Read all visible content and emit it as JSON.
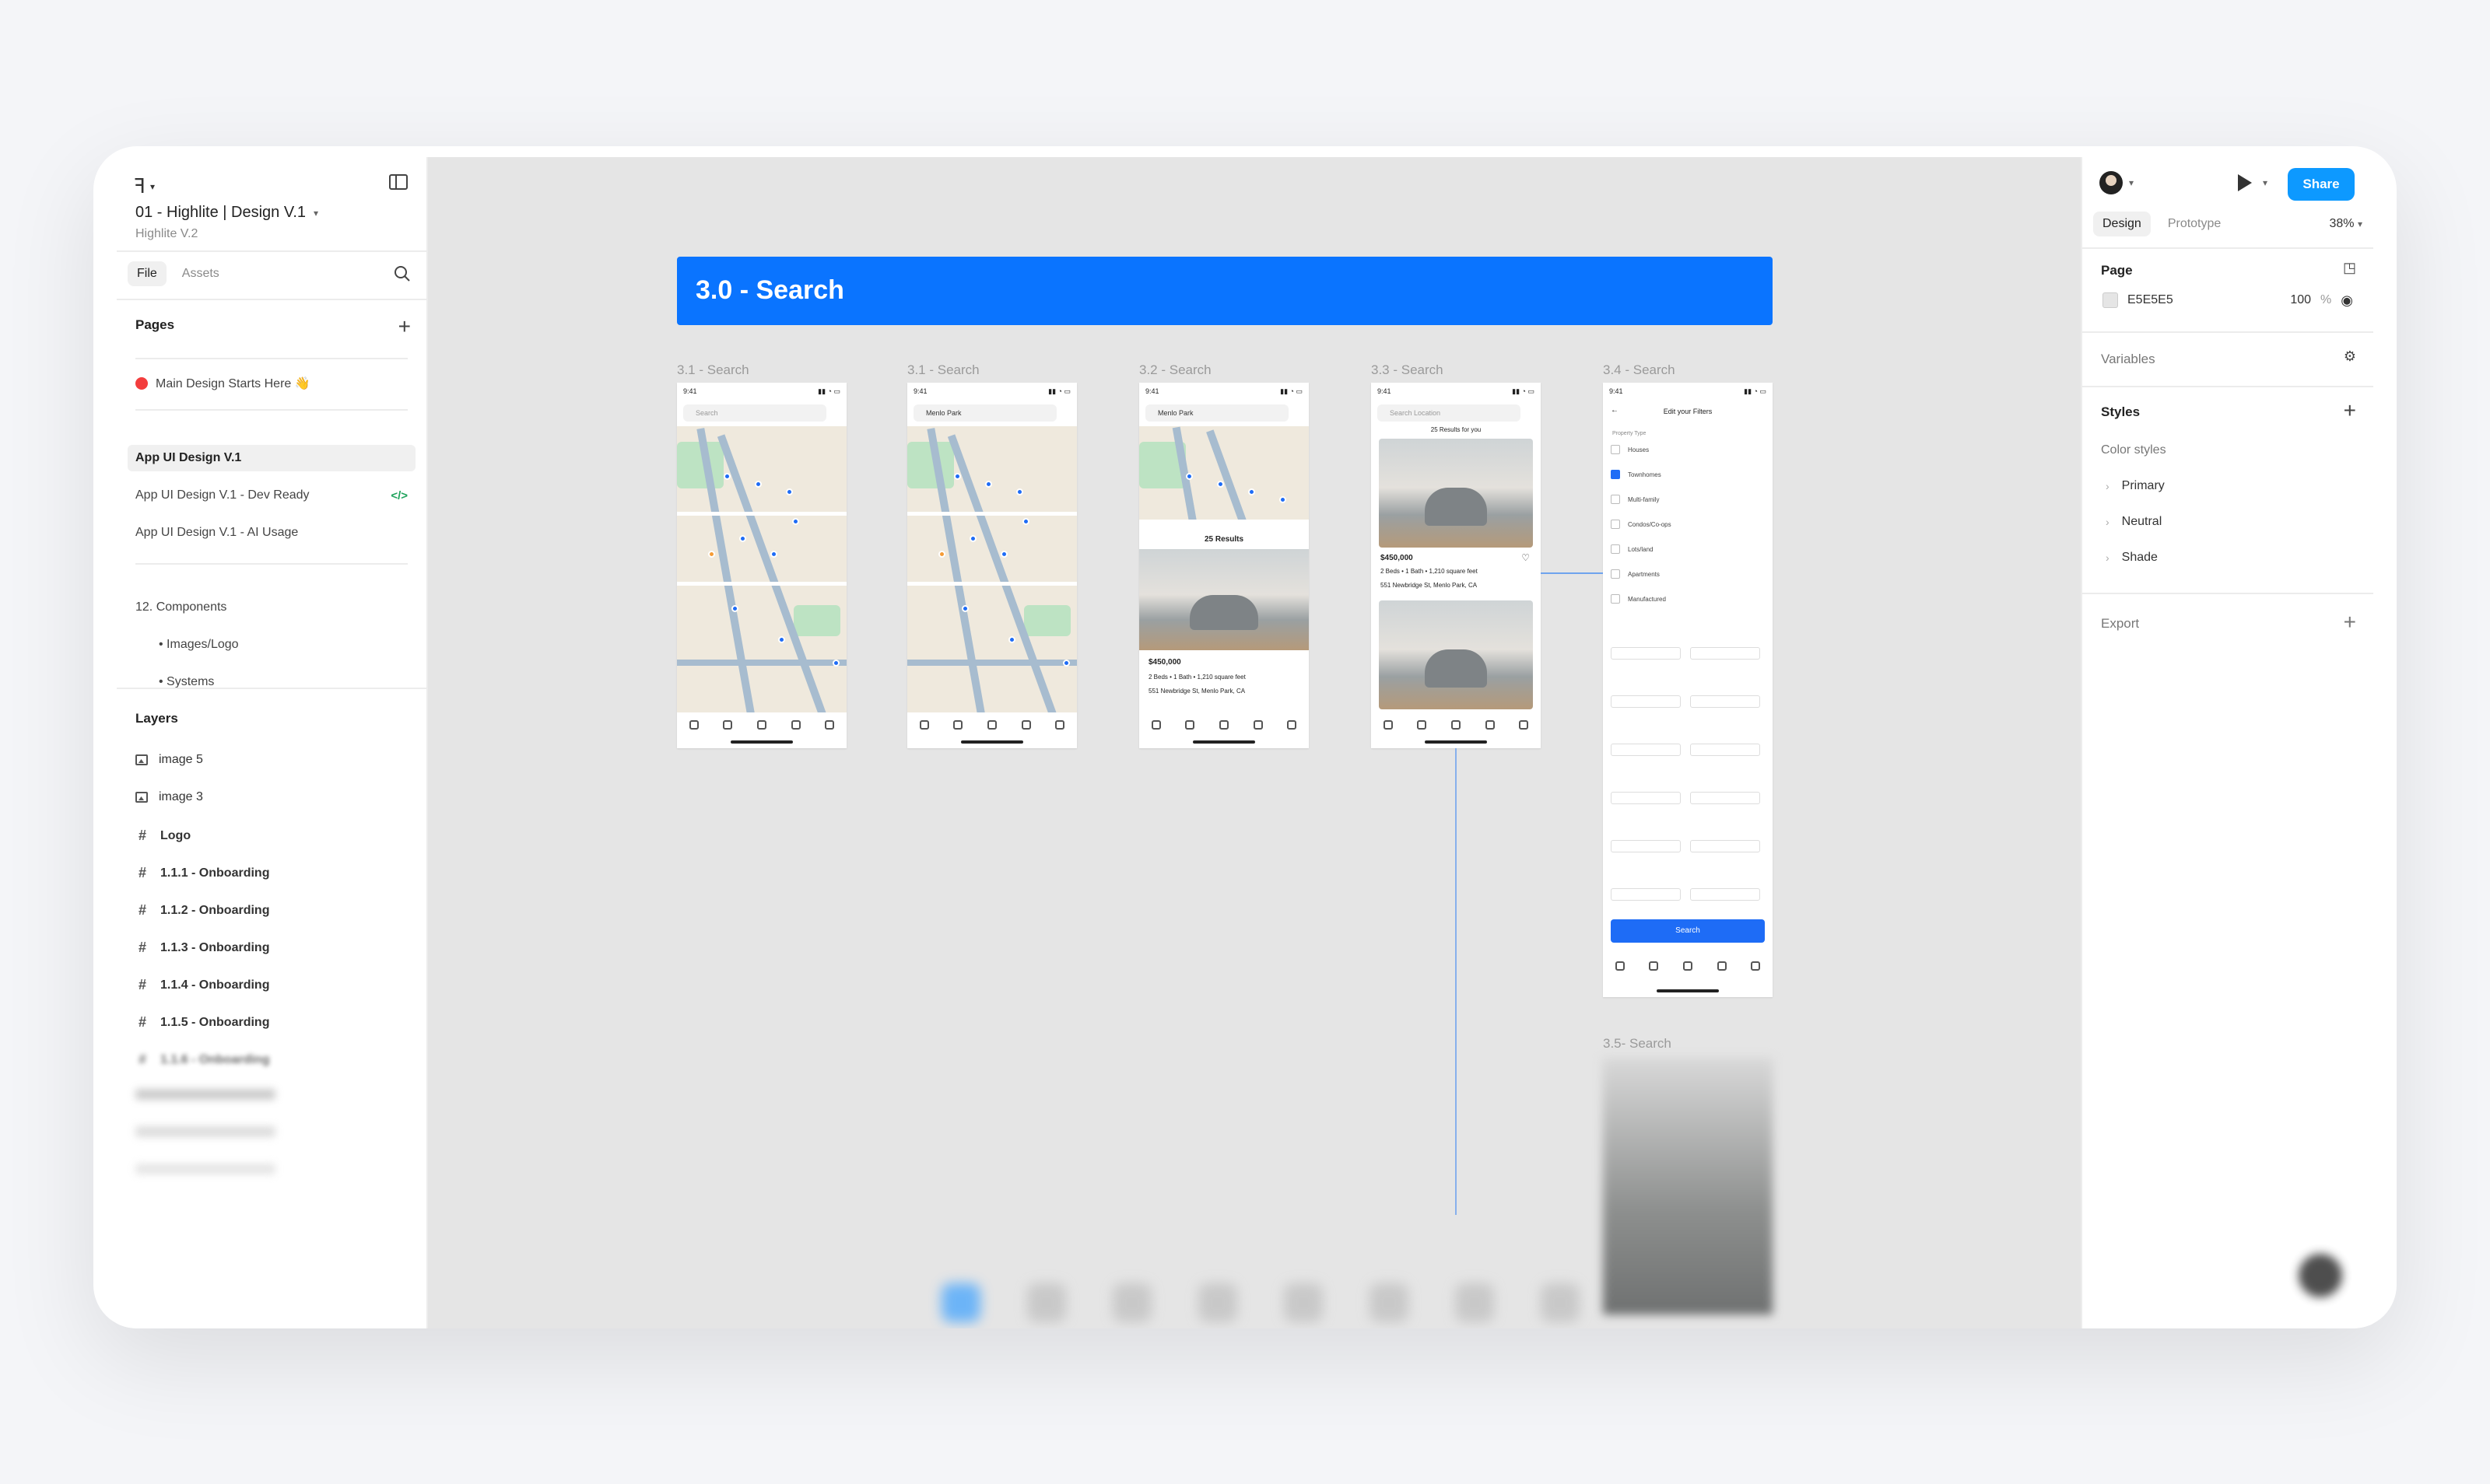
{
  "header": {
    "file_title": "01 - Highlite | Design V.1",
    "file_subtitle": "Highlite V.2"
  },
  "left_tabs": [
    "File",
    "Assets"
  ],
  "pages": {
    "title": "Pages",
    "items": [
      {
        "label": "Main Design Starts Here 👋"
      },
      {
        "label": "App UI Design V.1"
      },
      {
        "label": "App UI Design V.1 - Dev Ready",
        "badge": "</>"
      },
      {
        "label": "App UI Design V.1 - AI Usage"
      },
      {
        "label": "12. Components"
      },
      {
        "label": "• Images/Logo"
      },
      {
        "label": "• Systems"
      }
    ]
  },
  "layers": {
    "title": "Layers",
    "items": [
      {
        "label": "image 5",
        "icon": "image-icon"
      },
      {
        "label": "image 3",
        "icon": "image-icon"
      },
      {
        "label": "Logo",
        "icon": "frame-icon"
      },
      {
        "label": "1.1.1 - Onboarding",
        "icon": "frame-icon"
      },
      {
        "label": "1.1.2 - Onboarding",
        "icon": "frame-icon"
      },
      {
        "label": "1.1.3 - Onboarding",
        "icon": "frame-icon"
      },
      {
        "label": "1.1.4 - Onboarding",
        "icon": "frame-icon"
      },
      {
        "label": "1.1.5 - Onboarding",
        "icon": "frame-icon"
      },
      {
        "label": "1.1.6 - Onboarding",
        "icon": "frame-icon"
      }
    ]
  },
  "canvas": {
    "banner": "3.0 - Search",
    "frames": [
      {
        "label": "3.1 - Search",
        "search": "Search"
      },
      {
        "label": "3.1 - Search",
        "search": "Menlo Park"
      },
      {
        "label": "3.2 - Search",
        "search": "Menlo Park",
        "results": "25 Results",
        "price": "$450,000",
        "specs": "2 Beds  •  1 Bath  •  1,210 square feet",
        "address": "551 Newbridge St, Menlo Park, CA"
      },
      {
        "label": "3.3 - Search",
        "search": "Search Location",
        "results": "25 Results for you",
        "price": "$450,000",
        "specs": "2 Beds  •  1 Bath  •  1,210 square feet",
        "address": "551 Newbridge St, Menlo Park, CA"
      },
      {
        "label": "3.4 - Search",
        "title": "Edit your Filters",
        "button": "Search",
        "property_type": "Property Type",
        "types": [
          "Houses",
          "Townhomes",
          "Multi-family",
          "Condos/Co-ops",
          "Lots/land",
          "Apartments",
          "Manufactured"
        ]
      },
      {
        "label": "3.5- Search"
      }
    ],
    "time": "9:41"
  },
  "right": {
    "share": "Share",
    "tabs": [
      "Design",
      "Prototype"
    ],
    "zoom": "38%",
    "page_title": "Page",
    "page_color": "E5E5E5",
    "page_opacity": "100",
    "page_opacity_unit": "%",
    "variables": "Variables",
    "styles": "Styles",
    "color_styles": "Color styles",
    "color_groups": [
      "Primary",
      "Neutral",
      "Shade"
    ],
    "export": "Export"
  },
  "colors": {
    "accent": "#0d99ff",
    "banner": "#0a74ff",
    "canvas": "#e5e5e5"
  }
}
